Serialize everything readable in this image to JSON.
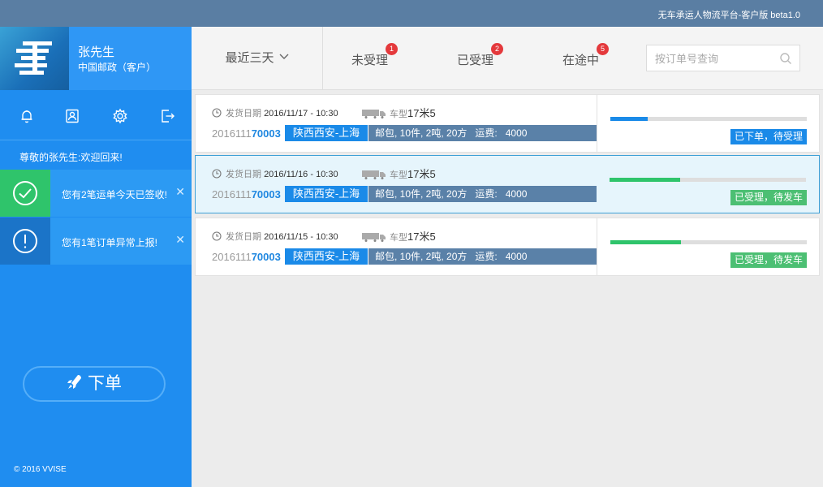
{
  "app_title": "无车承运人物流平台-客户版 beta1.0",
  "user": {
    "name": "张先生",
    "org": "中国邮政（客户）"
  },
  "welcome": "尊敬的张先生:欢迎回来!",
  "notices": [
    {
      "text": "您有2笔运单今天已签收!",
      "icon": "check-circle-icon",
      "color": "#2fc46b"
    },
    {
      "text": "您有1笔订单异常上报!",
      "icon": "exclamation-circle-icon",
      "color": "#1b74c8"
    }
  ],
  "place_order": "下单",
  "copyright": "© 2016 VVISE",
  "filter": {
    "label": "最近三天"
  },
  "tabs": [
    {
      "label": "未受理",
      "count": "1"
    },
    {
      "label": "已受理",
      "count": "2"
    },
    {
      "label": "在途中",
      "count": "5"
    }
  ],
  "search": {
    "placeholder": "按订单号查询",
    "value": ""
  },
  "labels": {
    "ship_date": "发货日期",
    "truck_type": "车型",
    "freight": "运费:"
  },
  "orders": [
    {
      "date": "2016/11/17 - 10:30",
      "truck": "17米5",
      "no_prefix": "2016111",
      "no_suffix": "70003",
      "route": "陕西西安-上海",
      "goods": "邮包, 10件, 2吨, 20方",
      "fee": "4000",
      "progress": 0.19,
      "progress_color": "#1a8ae8",
      "status": "已下单，待受理",
      "status_color": "#1a8ae8",
      "selected": false
    },
    {
      "date": "2016/11/16 - 10:30",
      "truck": "17米5",
      "no_prefix": "2016111",
      "no_suffix": "70003",
      "route": "陕西西安-上海",
      "goods": "邮包, 10件, 2吨, 20方",
      "fee": "4000",
      "progress": 0.36,
      "progress_color": "#2fc46b",
      "status": "已受理，待发车",
      "status_color": "#4cbf73",
      "selected": true
    },
    {
      "date": "2016/11/15 - 10:30",
      "truck": "17米5",
      "no_prefix": "2016111",
      "no_suffix": "70003",
      "route": "陕西西安-上海",
      "goods": "邮包, 10件, 2吨, 20方",
      "fee": "4000",
      "progress": 0.36,
      "progress_color": "#2fc46b",
      "status": "已受理，待发车",
      "status_color": "#4cbf73",
      "selected": false
    }
  ]
}
